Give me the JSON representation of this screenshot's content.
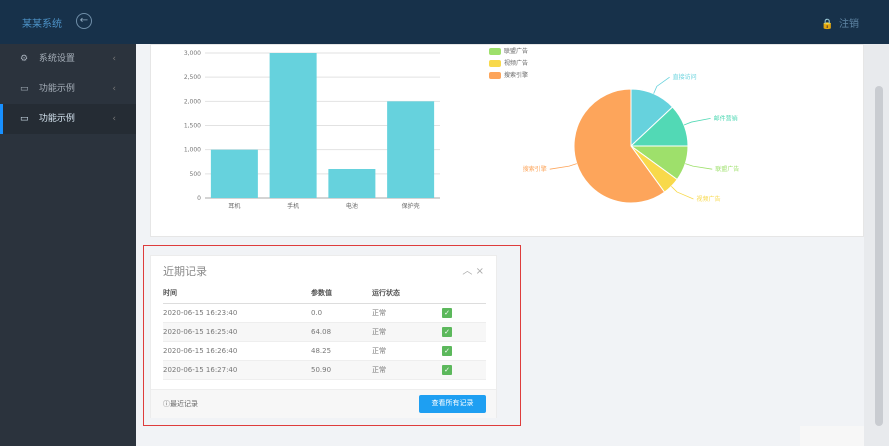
{
  "app": {
    "brand": "某某系统",
    "logout": "注销"
  },
  "icons": {
    "back": "back-circle-icon",
    "logout": "lock-icon",
    "settings": "settings-icon",
    "example1": "window-icon",
    "example2": "window-icon",
    "info": "info-icon",
    "collapse": "chevron-up-icon",
    "close": "close-icon",
    "status": "check-icon"
  },
  "sidebar": {
    "items": [
      {
        "label": "系统设置",
        "active": false
      },
      {
        "label": "功能示例",
        "active": false
      },
      {
        "label": "功能示例",
        "active": true
      }
    ]
  },
  "colors": {
    "topbar": "#17314a",
    "sidebar": "#2b333d",
    "accent": "#1890ff",
    "bar": "#66d2dd",
    "red_outline": "#de3c3c",
    "button": "#1e9ff2"
  },
  "chart_data": [
    {
      "type": "bar",
      "categories": [
        "耳机",
        "手机",
        "电池",
        "保护壳"
      ],
      "values": [
        1000,
        3000,
        600,
        2000
      ],
      "ylim": [
        0,
        3000
      ],
      "yticks": [
        0,
        500,
        1000,
        1500,
        2000,
        2500,
        3000
      ],
      "ytick_labels": [
        "0",
        "500",
        "1,000",
        "1,500",
        "2,000",
        "2,500",
        "3,000"
      ],
      "grid": true,
      "color": "#66d2dd"
    },
    {
      "type": "pie",
      "legend": [
        "联盟广告",
        "视频广告",
        "搜索引擎"
      ],
      "slices": [
        {
          "label": "直接访问",
          "value": 13,
          "color": "#66d2dd"
        },
        {
          "label": "邮件营销",
          "value": 12,
          "color": "#52d9b5"
        },
        {
          "label": "联盟广告",
          "value": 10,
          "color": "#9ee06b"
        },
        {
          "label": "视频广告",
          "value": 5,
          "color": "#f8d94b"
        },
        {
          "label": "搜索引擎",
          "value": 60,
          "color": "#fda55b"
        }
      ]
    }
  ],
  "records": {
    "title": "近期记录",
    "columns": [
      "时间",
      "参数值",
      "运行状态"
    ],
    "rows": [
      {
        "time": "2020-06-15 16:23:40",
        "value": "0.0",
        "status": "正常",
        "check": "✓"
      },
      {
        "time": "2020-06-15 16:25:40",
        "value": "64.08",
        "status": "正常",
        "check": "✓"
      },
      {
        "time": "2020-06-15 16:26:40",
        "value": "48.25",
        "status": "正常",
        "check": "✓"
      },
      {
        "time": "2020-06-15 16:27:40",
        "value": "50.90",
        "status": "正常",
        "check": "✓"
      }
    ],
    "footer_link": "最近记录",
    "view_all": "查看所有记录"
  }
}
